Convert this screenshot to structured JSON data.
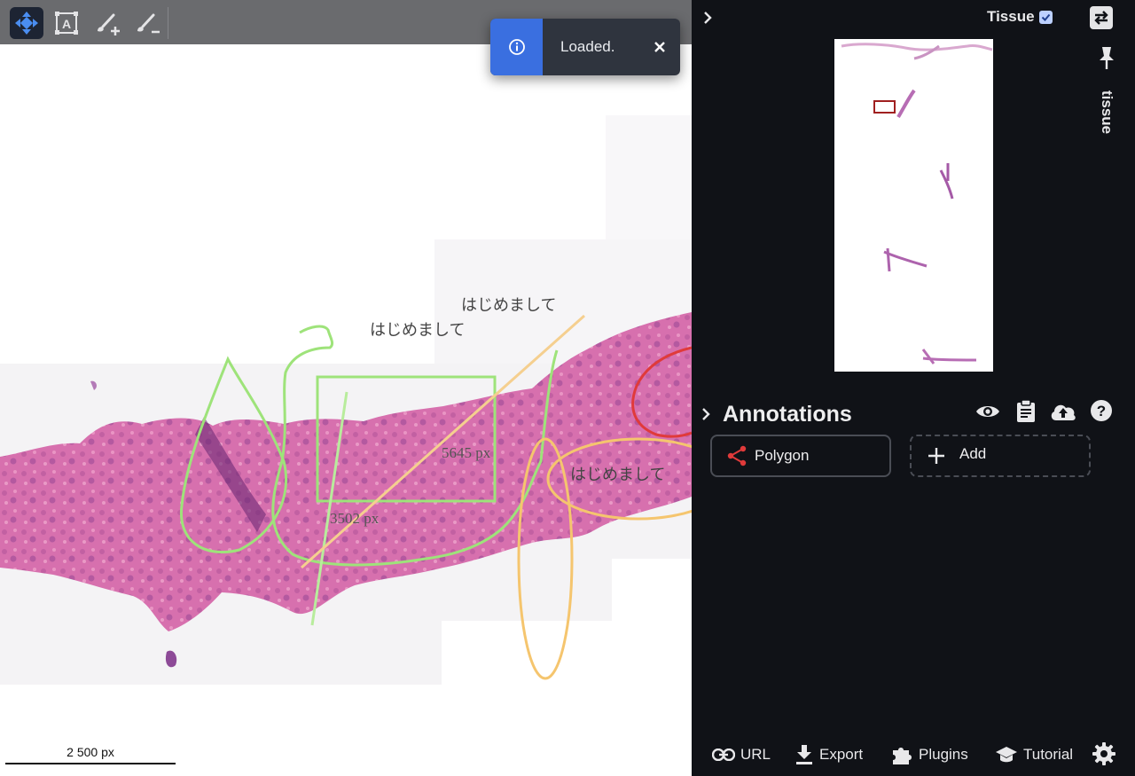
{
  "toolbar": {
    "tools": [
      {
        "name": "navigate-tool",
        "icon": "move-arrows-icon",
        "active": true
      },
      {
        "name": "text-region-tool",
        "icon": "text-box-icon",
        "active": false
      },
      {
        "name": "brush-add-tool",
        "icon": "brush-plus-icon",
        "active": false
      },
      {
        "name": "brush-remove-tool",
        "icon": "brush-minus-icon",
        "active": false
      }
    ]
  },
  "toast": {
    "icon": "info-icon",
    "message": "Loaded.",
    "close_icon": "close-icon",
    "accent": "#3a6fe0"
  },
  "viewer": {
    "annotation_texts": [
      "はじめまして",
      "はじめまして",
      "はじめまして"
    ],
    "measurements": [
      "5645 px",
      "3502 px"
    ],
    "scale_bar": "2 500 px",
    "colors": {
      "tissue": "#d76aa8",
      "green_annotation": "#9ee37a",
      "orange_annotation": "#f5c56e",
      "red_annotation": "#e03a3a"
    }
  },
  "panel": {
    "collapse_icon": "chevron-right-icon",
    "layer_label": "Tissue",
    "layer_checked": true,
    "swap_icon": "swap-icon",
    "pin_icon": "pin-icon",
    "pinned_label": "tissue",
    "annotations": {
      "title": "Annotations",
      "actions": [
        "eye-icon",
        "clipboard-icon",
        "cloud-upload-icon",
        "help-icon"
      ],
      "presets": [
        {
          "label": "Polygon",
          "icon": "polygon-share-icon",
          "color": "#e03a3a"
        }
      ],
      "add_label": "Add"
    },
    "bottom": {
      "url": "URL",
      "export": "Export",
      "plugins": "Plugins",
      "tutorial": "Tutorial",
      "settings_icon": "gear-icon"
    }
  }
}
